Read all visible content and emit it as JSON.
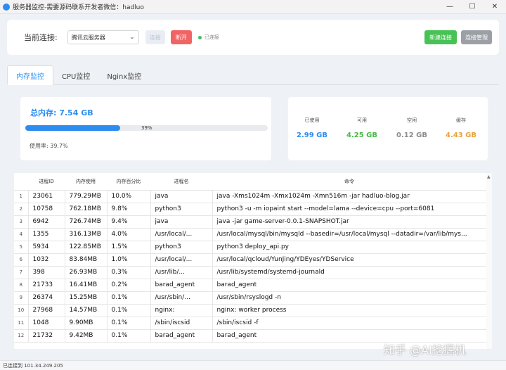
{
  "window": {
    "title": "服务器监控-需要源码联系开发者微信：hadluo",
    "controls": {
      "minimize": "—",
      "maximize": "☐",
      "close": "✕"
    }
  },
  "connection": {
    "label": "当前连接:",
    "selected_server": "腾讯云服务器",
    "connect_label": "连接",
    "disconnect_label": "断开",
    "status_text": "已连接",
    "new_label": "新建连接",
    "manage_label": "连接管理"
  },
  "tabs": [
    {
      "label": "内存监控",
      "active": true
    },
    {
      "label": "CPU监控",
      "active": false
    },
    {
      "label": "Nginx监控",
      "active": false
    }
  ],
  "memory": {
    "title": "总内存: 7.54 GB",
    "usage_fraction": 0.39,
    "progress_label": "39%",
    "usage_text": "使用率: 39.7%"
  },
  "stats": [
    {
      "label": "已使用",
      "value": "2.99 GB",
      "color": "#2d8cf0"
    },
    {
      "label": "可用",
      "value": "4.25 GB",
      "color": "#48b846"
    },
    {
      "label": "空闲",
      "value": "0.12 GB",
      "color": "#8c8c8c"
    },
    {
      "label": "缓存",
      "value": "4.43 GB",
      "color": "#e6a23c"
    }
  ],
  "table": {
    "headers": [
      "进程ID",
      "内存使用",
      "内存百分比",
      "进程名",
      "命令"
    ],
    "rows": [
      [
        "1",
        "23061",
        "779.29MB",
        "10.0%",
        "java",
        "java -Xms1024m -Xmx1024m -Xmn516m -jar hadluo-blog.jar"
      ],
      [
        "2",
        "10758",
        "762.18MB",
        "9.8%",
        "python3",
        "python3 -u -m iopaint start --model=lama --device=cpu --port=6081"
      ],
      [
        "3",
        "6942",
        "726.74MB",
        "9.4%",
        "java",
        "java -jar game-server-0.0.1-SNAPSHOT.jar"
      ],
      [
        "4",
        "1355",
        "316.13MB",
        "4.0%",
        "/usr/local/...",
        "/usr/local/mysql/bin/mysqld --basedir=/usr/local/mysql --datadir=/var/lib/mys..."
      ],
      [
        "5",
        "5934",
        "122.85MB",
        "1.5%",
        "python3",
        "python3 deploy_api.py"
      ],
      [
        "6",
        "1032",
        "83.84MB",
        "1.0%",
        "/usr/local/...",
        "/usr/local/qcloud/YunJing/YDEyes/YDService"
      ],
      [
        "7",
        "398",
        "26.93MB",
        "0.3%",
        "/usr/lib/...",
        "/usr/lib/systemd/systemd-journald"
      ],
      [
        "8",
        "21733",
        "16.41MB",
        "0.2%",
        "barad_agent",
        "barad_agent"
      ],
      [
        "9",
        "26374",
        "15.25MB",
        "0.1%",
        "/usr/sbin/...",
        "/usr/sbin/rsyslogd -n"
      ],
      [
        "10",
        "27968",
        "14.57MB",
        "0.1%",
        "nginx:",
        "nginx: worker process"
      ],
      [
        "11",
        "1048",
        "9.90MB",
        "0.1%",
        "/sbin/iscsid",
        "/sbin/iscsid -f"
      ],
      [
        "12",
        "21732",
        "9.42MB",
        "0.1%",
        "barad_agent",
        "barad_agent"
      ]
    ]
  },
  "statusbar": {
    "text": "已连接到 101.34.249.205"
  },
  "watermark": {
    "text": "知乎 @AI挖掘机"
  }
}
